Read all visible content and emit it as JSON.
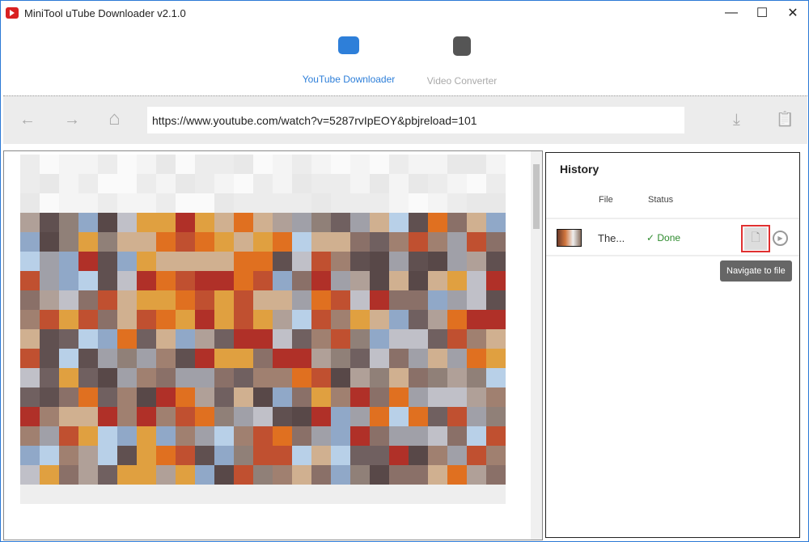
{
  "window": {
    "title": "MiniTool uTube Downloader v2.1.0",
    "minimize": "—",
    "maximize": "☐",
    "close": "✕"
  },
  "tabs": [
    {
      "label": "YouTube Downloader",
      "icon": "video-download-icon",
      "active": true
    },
    {
      "label": "Video Converter",
      "icon": "convert-icon",
      "active": false
    }
  ],
  "toolbar": {
    "back": "←",
    "forward": "→",
    "home": "⌂",
    "url": "https://www.youtube.com/watch?v=5287rvIpEOY&pbjreload=101",
    "download": "⤓",
    "clipboard": "📋"
  },
  "history": {
    "title": "History",
    "columns": {
      "file": "File",
      "status": "Status"
    },
    "items": [
      {
        "file": "The...",
        "status": "✓ Done"
      }
    ],
    "tooltip": "Navigate to file"
  },
  "colors": {
    "accent": "#2e7fd9",
    "done": "#2e8b2e",
    "highlight": "#e03030"
  }
}
